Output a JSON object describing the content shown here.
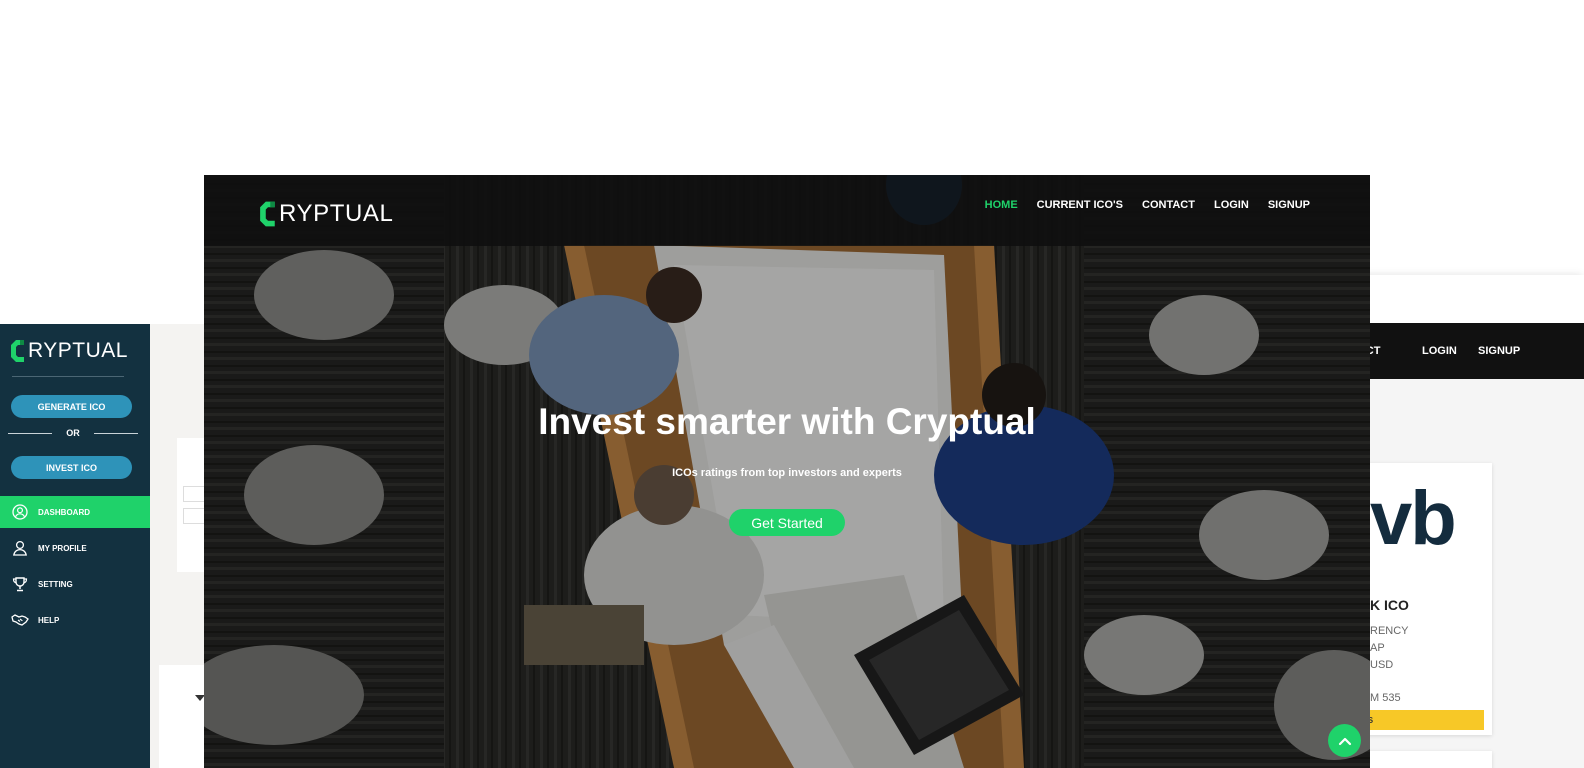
{
  "brand": {
    "name": "RYPTUAL",
    "accent": "#1fd26a",
    "navy": "#133140",
    "blue": "#2e93b9"
  },
  "dashboard": {
    "logo_text": "RYPTUAL",
    "generate_label": "GENERATE ICO",
    "or_label": "OR",
    "invest_label": "INVEST ICO",
    "menu": [
      {
        "label": "DASHBOARD",
        "icon": "user-circle-icon",
        "active": true
      },
      {
        "label": "MY PROFILE",
        "icon": "user-icon",
        "active": false
      },
      {
        "label": "SETTING",
        "icon": "trophy-icon",
        "active": false
      },
      {
        "label": "HELP",
        "icon": "handshake-icon",
        "active": false
      }
    ]
  },
  "hero": {
    "logo_text": "RYPTUAL",
    "nav": [
      {
        "label": "HOME",
        "active": true
      },
      {
        "label": "CURRENT ICO'S",
        "active": false
      },
      {
        "label": "CONTACT",
        "active": false
      },
      {
        "label": "LOGIN",
        "active": false
      },
      {
        "label": "SIGNUP",
        "active": false
      }
    ],
    "title": "Invest smarter with Cryptual",
    "subtitle": "ICOs ratings from top investors and experts",
    "cta_label": "Get Started"
  },
  "right_mock": {
    "nav": [
      "NTACT",
      "LOGIN",
      "SIGNUP"
    ],
    "card_logo": "vb",
    "card_title": "K ICO",
    "lines": [
      "RENCY",
      "AP",
      "USD",
      "M 535"
    ],
    "button_label": "NS"
  }
}
